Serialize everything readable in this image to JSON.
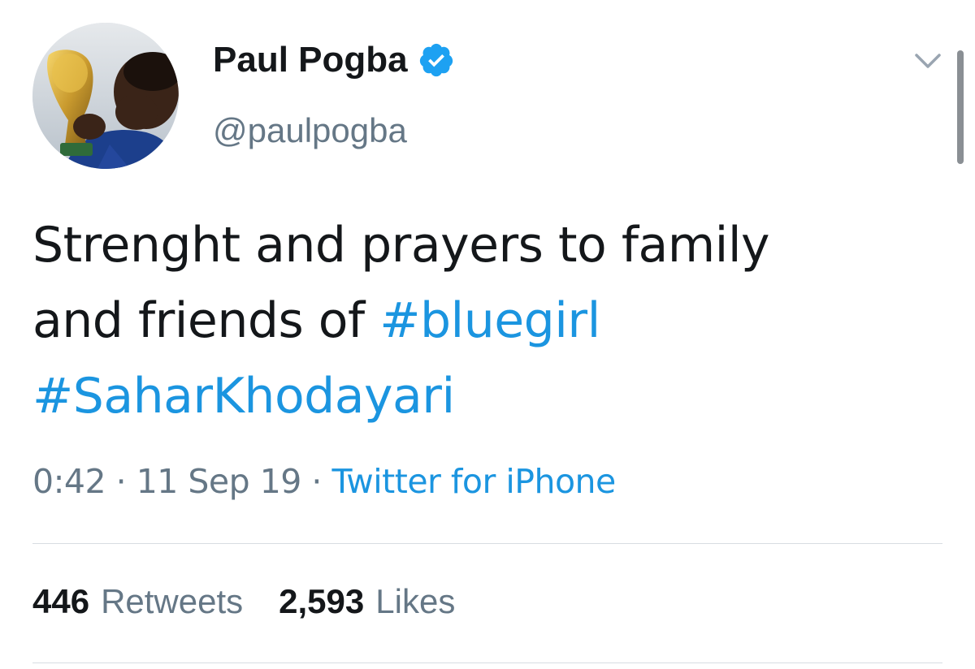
{
  "user": {
    "display_name": "Paul Pogba",
    "handle": "@paulpogba",
    "verified": true
  },
  "tweet": {
    "text_plain_1": "Strenght and prayers to family",
    "text_plain_2": "and friends of ",
    "hashtag_1": "#bluegirl",
    "hashtag_2": "#SaharKhodayari"
  },
  "meta": {
    "time": "0:42",
    "separator_1": " · ",
    "date": "11 Sep 19",
    "separator_2": " · ",
    "source": "Twitter for iPhone"
  },
  "stats": {
    "retweets_count": "446",
    "retweets_label": "Retweets",
    "likes_count": "2,593",
    "likes_label": "Likes"
  },
  "icons": {
    "verified": "verified-badge-icon",
    "caret": "chevron-down-icon"
  },
  "colors": {
    "link": "#1b95e0",
    "secondary_text": "#657786",
    "verified_badge": "#1da1f2"
  }
}
